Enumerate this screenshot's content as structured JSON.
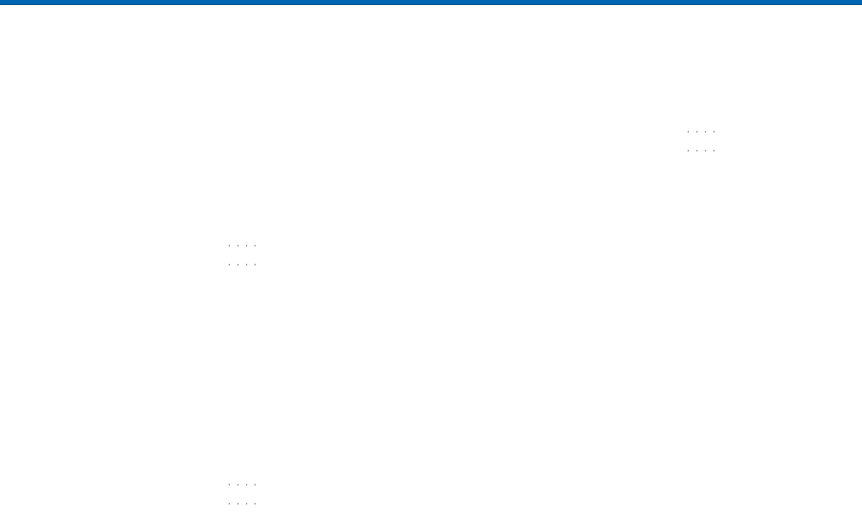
{
  "dots": {
    "pattern": "····"
  }
}
